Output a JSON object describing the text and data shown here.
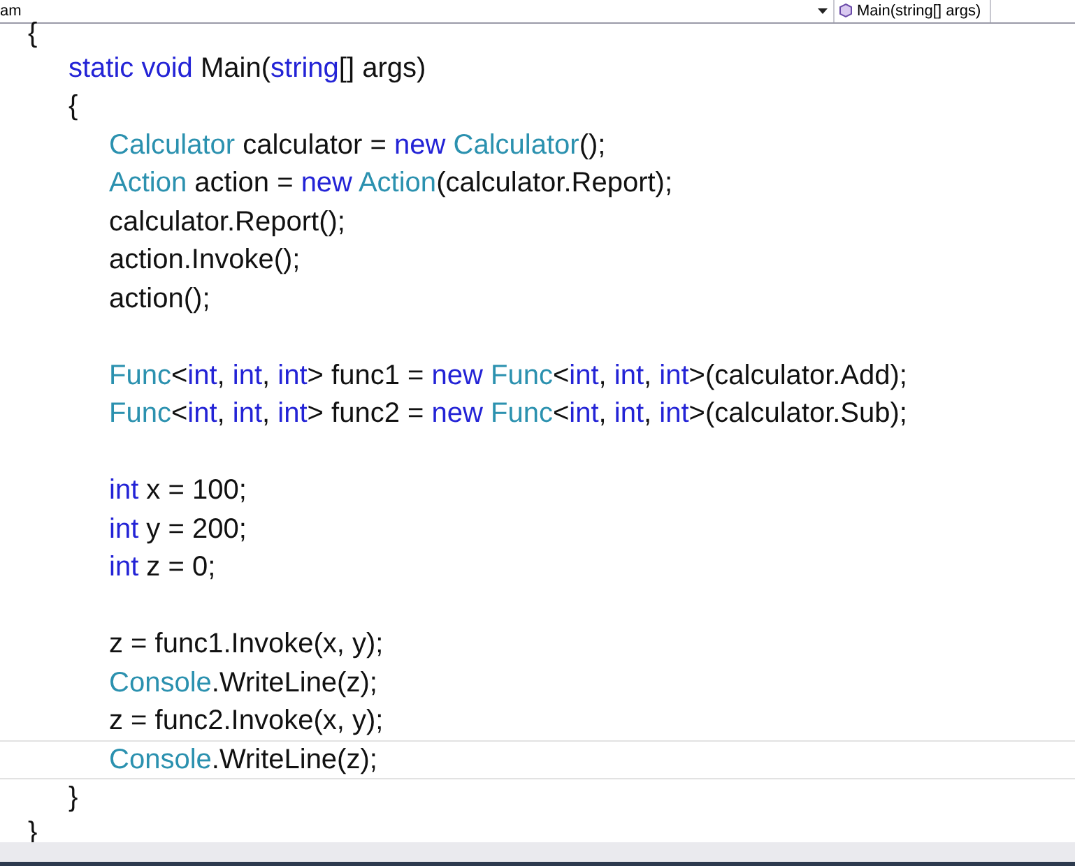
{
  "navigation_bar": {
    "type_dropdown": {
      "value": "am"
    },
    "member_dropdown": {
      "value": "Main(string[] args)"
    }
  },
  "code_lines": [
    {
      "current": false,
      "tokens": [
        {
          "kind": "plain",
          "text": "{"
        }
      ]
    },
    {
      "current": false,
      "tokens": [
        {
          "kind": "keyword",
          "text": "\tstatic"
        },
        {
          "kind": "keyword",
          "text": " void"
        },
        {
          "kind": "plain",
          "text": " Main("
        },
        {
          "kind": "keyword",
          "text": "string"
        },
        {
          "kind": "plain",
          "text": "[] args)"
        }
      ]
    },
    {
      "current": false,
      "tokens": [
        {
          "kind": "plain",
          "text": "\t{"
        }
      ]
    },
    {
      "current": false,
      "tokens": [
        {
          "kind": "type",
          "text": "\t\tCalculator"
        },
        {
          "kind": "plain",
          "text": " calculator = "
        },
        {
          "kind": "keyword",
          "text": "new"
        },
        {
          "kind": "type",
          "text": " Calculator"
        },
        {
          "kind": "plain",
          "text": "();"
        }
      ]
    },
    {
      "current": false,
      "tokens": [
        {
          "kind": "type",
          "text": "\t\tAction"
        },
        {
          "kind": "plain",
          "text": " action = "
        },
        {
          "kind": "keyword",
          "text": "new"
        },
        {
          "kind": "type",
          "text": " Action"
        },
        {
          "kind": "plain",
          "text": "(calculator.Report);"
        }
      ]
    },
    {
      "current": false,
      "tokens": [
        {
          "kind": "plain",
          "text": "\t\tcalculator.Report();"
        }
      ]
    },
    {
      "current": false,
      "tokens": [
        {
          "kind": "plain",
          "text": "\t\taction.Invoke();"
        }
      ]
    },
    {
      "current": false,
      "tokens": [
        {
          "kind": "plain",
          "text": "\t\taction();"
        }
      ]
    },
    {
      "current": false
    },
    {
      "current": false,
      "tokens": [
        {
          "kind": "type",
          "text": "\t\tFunc"
        },
        {
          "kind": "plain",
          "text": "<"
        },
        {
          "kind": "keyword",
          "text": "int"
        },
        {
          "kind": "plain",
          "text": ", "
        },
        {
          "kind": "keyword",
          "text": "int"
        },
        {
          "kind": "plain",
          "text": ", "
        },
        {
          "kind": "keyword",
          "text": "int"
        },
        {
          "kind": "plain",
          "text": "> func1 = "
        },
        {
          "kind": "keyword",
          "text": "new"
        },
        {
          "kind": "type",
          "text": " Func"
        },
        {
          "kind": "plain",
          "text": "<"
        },
        {
          "kind": "keyword",
          "text": "int"
        },
        {
          "kind": "plain",
          "text": ", "
        },
        {
          "kind": "keyword",
          "text": "int"
        },
        {
          "kind": "plain",
          "text": ", "
        },
        {
          "kind": "keyword",
          "text": "int"
        },
        {
          "kind": "plain",
          "text": ">(calculator.Add);"
        }
      ]
    },
    {
      "current": false,
      "tokens": [
        {
          "kind": "type",
          "text": "\t\tFunc"
        },
        {
          "kind": "plain",
          "text": "<"
        },
        {
          "kind": "keyword",
          "text": "int"
        },
        {
          "kind": "plain",
          "text": ", "
        },
        {
          "kind": "keyword",
          "text": "int"
        },
        {
          "kind": "plain",
          "text": ", "
        },
        {
          "kind": "keyword",
          "text": "int"
        },
        {
          "kind": "plain",
          "text": "> func2 = "
        },
        {
          "kind": "keyword",
          "text": "new"
        },
        {
          "kind": "type",
          "text": " Func"
        },
        {
          "kind": "plain",
          "text": "<"
        },
        {
          "kind": "keyword",
          "text": "int"
        },
        {
          "kind": "plain",
          "text": ", "
        },
        {
          "kind": "keyword",
          "text": "int"
        },
        {
          "kind": "plain",
          "text": ", "
        },
        {
          "kind": "keyword",
          "text": "int"
        },
        {
          "kind": "plain",
          "text": ">(calculator.Sub);"
        }
      ]
    },
    {
      "current": false
    },
    {
      "current": false,
      "tokens": [
        {
          "kind": "keyword",
          "text": "\t\tint"
        },
        {
          "kind": "plain",
          "text": " x = 100;"
        }
      ]
    },
    {
      "current": false,
      "tokens": [
        {
          "kind": "keyword",
          "text": "\t\tint"
        },
        {
          "kind": "plain",
          "text": " y = 200;"
        }
      ]
    },
    {
      "current": false,
      "tokens": [
        {
          "kind": "keyword",
          "text": "\t\tint"
        },
        {
          "kind": "plain",
          "text": " z = 0;"
        }
      ]
    },
    {
      "current": false
    },
    {
      "current": false,
      "tokens": [
        {
          "kind": "plain",
          "text": "\t\tz = func1.Invoke(x, y);"
        }
      ]
    },
    {
      "current": false,
      "tokens": [
        {
          "kind": "type",
          "text": "\t\tConsole"
        },
        {
          "kind": "plain",
          "text": ".WriteLine(z);"
        }
      ]
    },
    {
      "current": false,
      "tokens": [
        {
          "kind": "plain",
          "text": "\t\tz = func2.Invoke(x, y);"
        }
      ]
    },
    {
      "current": true,
      "tokens": [
        {
          "kind": "type",
          "text": "\t\tConsole"
        },
        {
          "kind": "plain",
          "text": ".WriteLine(z);"
        }
      ]
    },
    {
      "current": false,
      "tokens": [
        {
          "kind": "plain",
          "text": "\t}"
        }
      ]
    },
    {
      "current": false,
      "tokens": [
        {
          "kind": "plain",
          "text": "}"
        }
      ]
    }
  ]
}
